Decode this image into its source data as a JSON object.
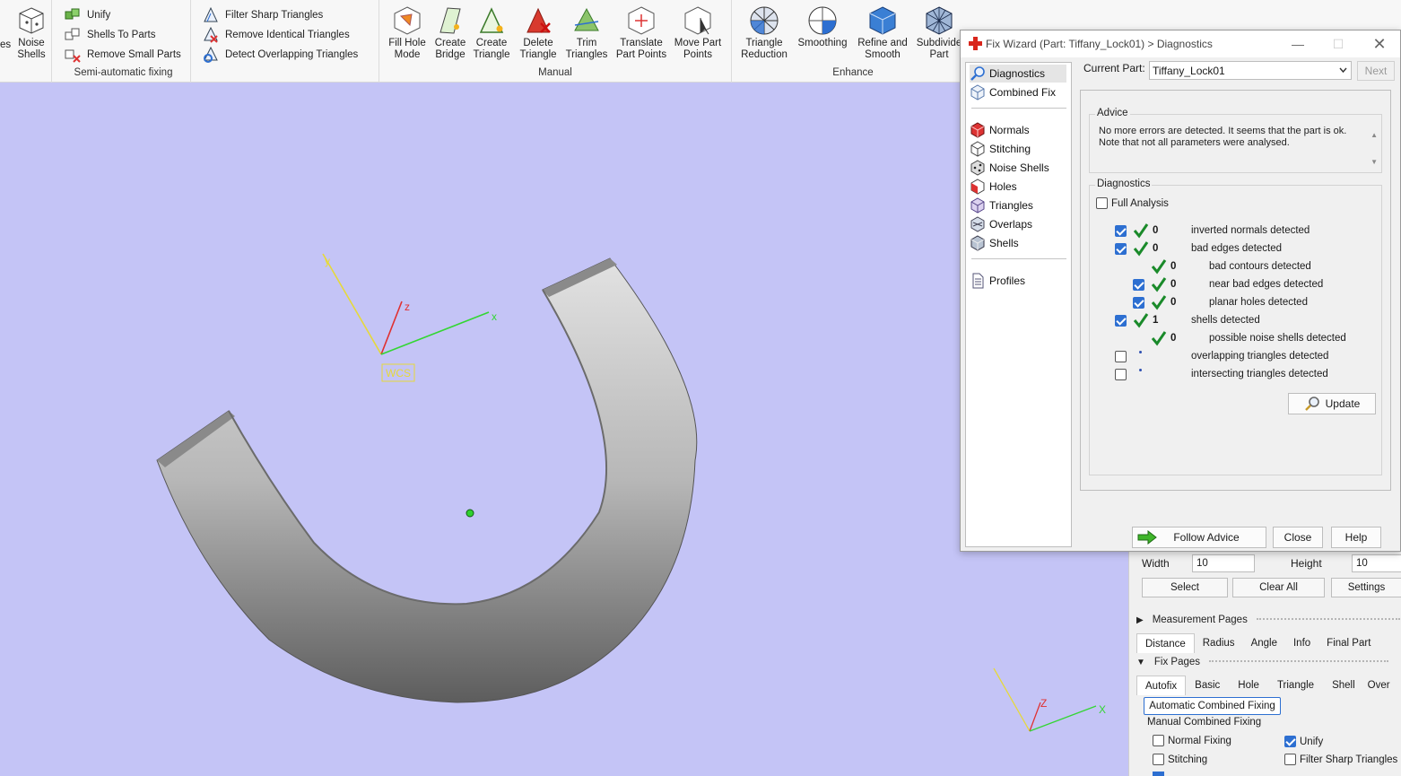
{
  "ribbon": {
    "partial_left_label": "es",
    "noise_shells": "Noise\nShells",
    "semi_auto": {
      "label": "Semi-automatic fixing",
      "unify": "Unify",
      "shells_to_parts": "Shells To Parts",
      "remove_small_parts": "Remove Small Parts"
    },
    "filter_group": {
      "filter_sharp": "Filter Sharp Triangles",
      "remove_identical": "Remove Identical Triangles",
      "detect_overlapping": "Detect Overlapping Triangles"
    },
    "manual": {
      "label": "Manual",
      "fill_hole": "Fill Hole\nMode",
      "create_bridge": "Create\nBridge",
      "create_triangle": "Create\nTriangle",
      "delete_triangle": "Delete\nTriangle",
      "trim_triangles": "Trim\nTriangles",
      "translate_points": "Translate\nPart Points",
      "move_points": "Move Part\nPoints"
    },
    "enhance": {
      "label": "Enhance",
      "triangle_reduction": "Triangle\nReduction",
      "smoothing": "Smoothing",
      "refine_smooth": "Refine and\nSmooth",
      "subdivide": "Subdivide\nPart"
    }
  },
  "viewport": {
    "wcs_label": "WCS",
    "axis_x": "x",
    "axis_y": "y",
    "axis_z": "z",
    "mini_axis_z": "Z",
    "mini_axis_x": "X"
  },
  "dialog": {
    "title": "Fix Wizard (Part: Tiffany_Lock01) > Diagnostics",
    "nav": {
      "diagnostics": "Diagnostics",
      "combined_fix": "Combined Fix",
      "normals": "Normals",
      "stitching": "Stitching",
      "noise_shells": "Noise Shells",
      "holes": "Holes",
      "triangles": "Triangles",
      "overlaps": "Overlaps",
      "shells": "Shells",
      "profiles": "Profiles"
    },
    "current_part_label": "Current Part:",
    "current_part_value": "Tiffany_Lock01",
    "next": "Next",
    "advice": {
      "legend": "Advice",
      "line1": "No more errors are detected. It seems that the part is ok.",
      "line2": "Note that not all parameters were analysed."
    },
    "diagnostics": {
      "legend": "Diagnostics",
      "full_analysis": "Full Analysis",
      "rows": [
        {
          "count": "0",
          "label": "inverted normals detected"
        },
        {
          "count": "0",
          "label": "bad edges detected"
        },
        {
          "count": "0",
          "label": "bad contours detected"
        },
        {
          "count": "0",
          "label": "near bad edges detected"
        },
        {
          "count": "0",
          "label": "planar holes detected"
        },
        {
          "count": "1",
          "label": "shells detected"
        },
        {
          "count": "0",
          "label": "possible noise shells detected"
        },
        {
          "count": "",
          "label": "overlapping triangles detected"
        },
        {
          "count": "",
          "label": "intersecting triangles detected"
        }
      ],
      "update": "Update"
    },
    "follow_advice": "Follow Advice",
    "close": "Close",
    "help": "Help"
  },
  "panel": {
    "width_label": "Width",
    "width_value": "10",
    "height_label": "Height",
    "height_value": "10",
    "select": "Select",
    "clear_all": "Clear All",
    "settings": "Settings",
    "measurement_pages": "Measurement Pages",
    "measure_tabs": [
      "Distance",
      "Radius",
      "Angle",
      "Info",
      "Final Part"
    ],
    "fix_pages": "Fix Pages",
    "fix_tabs": [
      "Autofix",
      "Basic",
      "Hole",
      "Triangle",
      "Shell",
      "Over"
    ],
    "auto_combined": "Automatic Combined Fixing",
    "manual_combined": "Manual Combined Fixing",
    "normal_fixing": "Normal Fixing",
    "unify": "Unify",
    "stitching": "Stitching",
    "filter_sharp": "Filter Sharp Triangles"
  }
}
